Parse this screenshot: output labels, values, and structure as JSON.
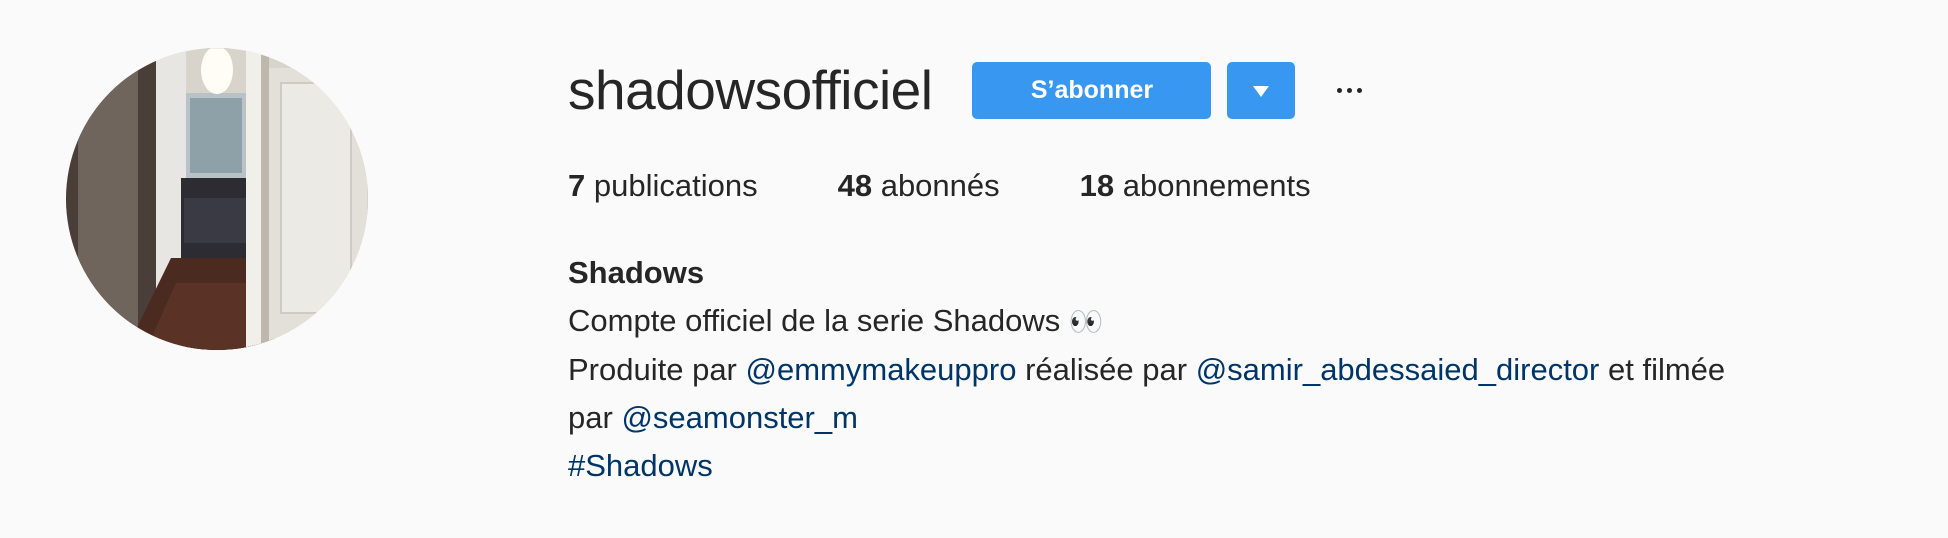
{
  "profile": {
    "username": "shadowsofficiel",
    "follow_label": "S’abonner",
    "avatar_alt": "shadowsofficiel"
  },
  "stats": [
    {
      "count": "7",
      "label": "publications"
    },
    {
      "count": "48",
      "label": "abonnés"
    },
    {
      "count": "18",
      "label": "abonnements"
    }
  ],
  "bio": {
    "name": "Shadows",
    "line1_text": "Compte officiel de la serie Shadows",
    "line1_emoji": "👀",
    "line2_pre": "Produite par",
    "line2_mention1": "@emmymakeuppro",
    "line2_mid": "réalisée par",
    "line2_mention2": "@samir_abdessaied_director",
    "line2_post": "et filmée",
    "line3_pre": "par",
    "line3_mention": "@seamonster_m",
    "hashtag": "#Shadows"
  },
  "colors": {
    "background": "#fafafa",
    "button": "#3897f0",
    "link": "#003569",
    "text": "#262626"
  },
  "icons": {
    "dropdown": "chevron-down-icon",
    "more": "more-options-icon"
  }
}
